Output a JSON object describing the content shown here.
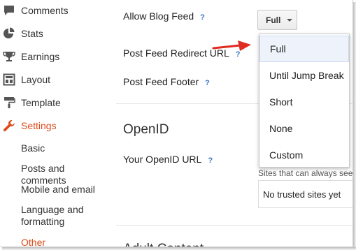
{
  "sidebar": {
    "items": [
      {
        "label": "Comments",
        "icon": "comment-icon"
      },
      {
        "label": "Stats",
        "icon": "pie-chart-icon"
      },
      {
        "label": "Earnings",
        "icon": "trophy-icon"
      },
      {
        "label": "Layout",
        "icon": "layout-icon"
      },
      {
        "label": "Template",
        "icon": "paint-roller-icon"
      },
      {
        "label": "Settings",
        "icon": "wrench-icon"
      }
    ],
    "subitems": [
      "Basic",
      "Posts and comments",
      "Mobile and email",
      "Language and formatting",
      "Other"
    ],
    "active_item": "Settings",
    "current_subitem": "Other",
    "accent_color": "#dd4b1a"
  },
  "settings": {
    "allow_blog_feed": "Allow Blog Feed",
    "post_feed_redirect_url": "Post Feed Redirect URL",
    "post_feed_footer": "Post Feed Footer",
    "help_mark": "?",
    "feed_select": {
      "value": "Full",
      "options": [
        "Full",
        "Until Jump Break",
        "Short",
        "None",
        "Custom"
      ]
    }
  },
  "openid": {
    "title": "OpenID",
    "url_label": "Your OpenID URL",
    "trusted_caption": "Sites that can always see y",
    "trusted_value": "No trusted sites yet"
  },
  "next_section_partial": "Adult Content"
}
